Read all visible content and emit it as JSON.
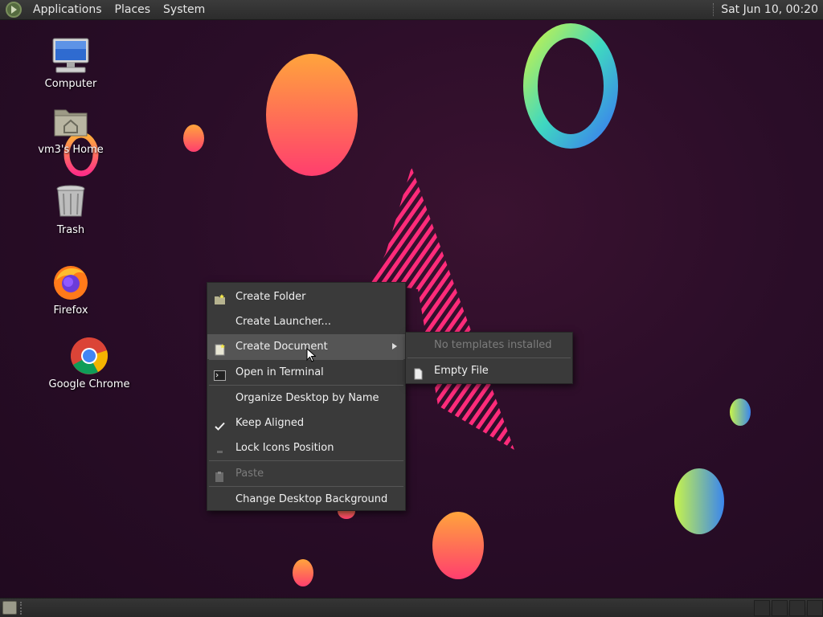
{
  "top_panel": {
    "menus": [
      "Applications",
      "Places",
      "System"
    ],
    "clock": "Sat Jun 10, 00:20"
  },
  "desktop_icons": [
    {
      "label": "Computer",
      "icon": "computer-icon"
    },
    {
      "label": "vm3's Home",
      "icon": "home-folder-icon"
    },
    {
      "label": "Trash",
      "icon": "trash-icon"
    },
    {
      "label": "Firefox",
      "icon": "firefox-icon"
    },
    {
      "label": "Google Chrome",
      "icon": "chrome-icon"
    }
  ],
  "context_menu": {
    "create_folder": "Create Folder",
    "create_launcher": "Create Launcher...",
    "create_document": "Create Document",
    "open_terminal": "Open in Terminal",
    "organize": "Organize Desktop by Name",
    "keep_aligned": "Keep Aligned",
    "lock_icons": "Lock Icons Position",
    "paste": "Paste",
    "change_background": "Change Desktop Background"
  },
  "submenu": {
    "no_templates": "No templates installed",
    "empty_file": "Empty File"
  },
  "colors": {
    "panel": "#2f2f2f",
    "menu_bg": "#3a3a3a",
    "menu_highlight": "#555555",
    "wallpaper": "#2a0d28"
  }
}
